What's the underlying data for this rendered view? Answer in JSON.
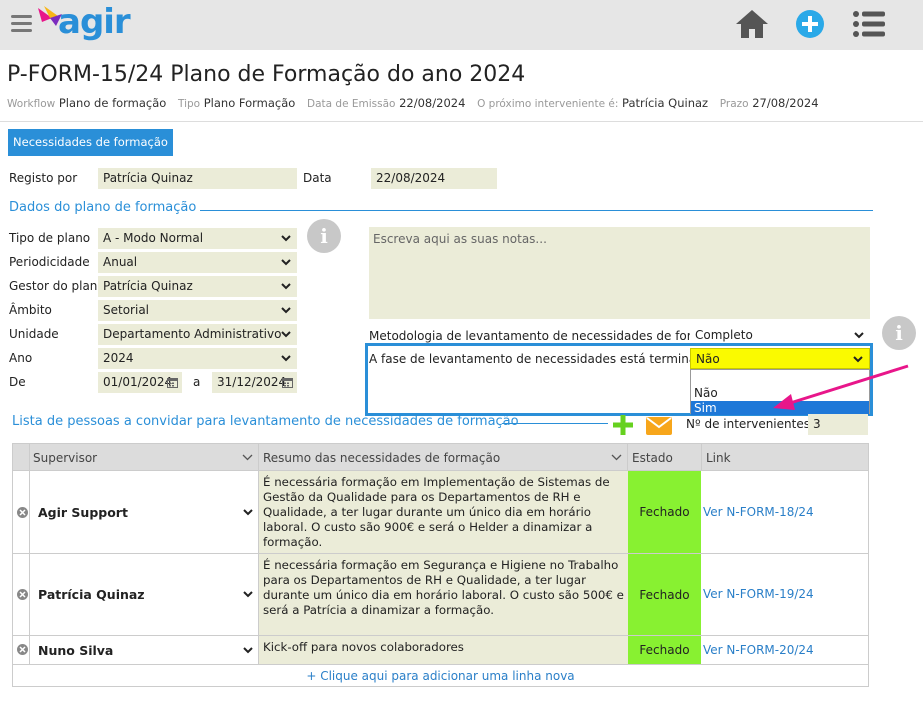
{
  "app": {
    "logo_text": "agir"
  },
  "header": {
    "title": "P-FORM-15/24 Plano de Formação do ano 2024",
    "meta": [
      {
        "label": "Workflow",
        "value": "Plano de formação"
      },
      {
        "label": "Tipo",
        "value": "Plano Formação"
      },
      {
        "label": "Data de Emissão",
        "value": "22/08/2024"
      },
      {
        "label": "O próximo interveniente é:",
        "value": "Patrícia Quinaz"
      },
      {
        "label": "Prazo",
        "value": "27/08/2024"
      }
    ]
  },
  "tab": {
    "label": "Necessidades de formação"
  },
  "registo": {
    "label": "Registo por",
    "value": "Patrícia Quinaz",
    "data_label": "Data",
    "data_value": "22/08/2024"
  },
  "section": {
    "title": "Dados do plano de formação"
  },
  "fields": {
    "tipo": {
      "label": "Tipo de plano",
      "value": "A - Modo Normal"
    },
    "periodicidade": {
      "label": "Periodicidade",
      "value": "Anual"
    },
    "gestor": {
      "label": "Gestor do plano",
      "value": "Patrícia Quinaz"
    },
    "ambito": {
      "label": "Âmbito",
      "value": "Setorial"
    },
    "unidade": {
      "label": "Unidade",
      "value": "Departamento Administrativo"
    },
    "ano": {
      "label": "Ano",
      "value": "2024"
    },
    "de": {
      "label": "De",
      "from": "01/01/2024",
      "sep": "a",
      "to": "31/12/2024"
    }
  },
  "notes": {
    "placeholder": "Escreva aqui as suas notas..."
  },
  "metodologia": {
    "label": "Metodologia de levantamento de necessidades de formação",
    "value": "Completo"
  },
  "fase": {
    "label": "A fase de levantamento de necessidades está terminada?",
    "value": "Não",
    "options": [
      "Não",
      "Sim"
    ]
  },
  "list": {
    "title": "Lista de pessoas a convidar para levantamento de necessidades de formação",
    "interv_label": "Nº de intervenientes",
    "interv_value": "3",
    "columns": [
      "Supervisor",
      "Resumo das necessidades de formação",
      "Estado",
      "Link"
    ],
    "rows": [
      {
        "supervisor": "Agir Support",
        "summary": "É necessária formação em Implementação de Sistemas de Gestão da Qualidade para os Departamentos de RH e Qualidade, a ter lugar durante um único dia em horário laboral. O custo são 900€ e será o Helder a dinamizar a formação.",
        "estado": "Fechado",
        "link": "Ver N-FORM-18/24"
      },
      {
        "supervisor": "Patrícia Quinaz",
        "summary": "É necessária formação em Segurança e Higiene no Trabalho para os Departamentos de RH e Qualidade, a ter lugar durante um único dia em horário laboral. O custo são 500€ e será a Patrícia a dinamizar a formação.",
        "estado": "Fechado",
        "link": "Ver N-FORM-19/24"
      },
      {
        "supervisor": "Nuno Silva",
        "summary": "Kick-off para novos colaboradores",
        "estado": "Fechado",
        "link": "Ver N-FORM-20/24"
      }
    ],
    "add_row": "+ Clique aqui para adicionar uma linha nova"
  }
}
